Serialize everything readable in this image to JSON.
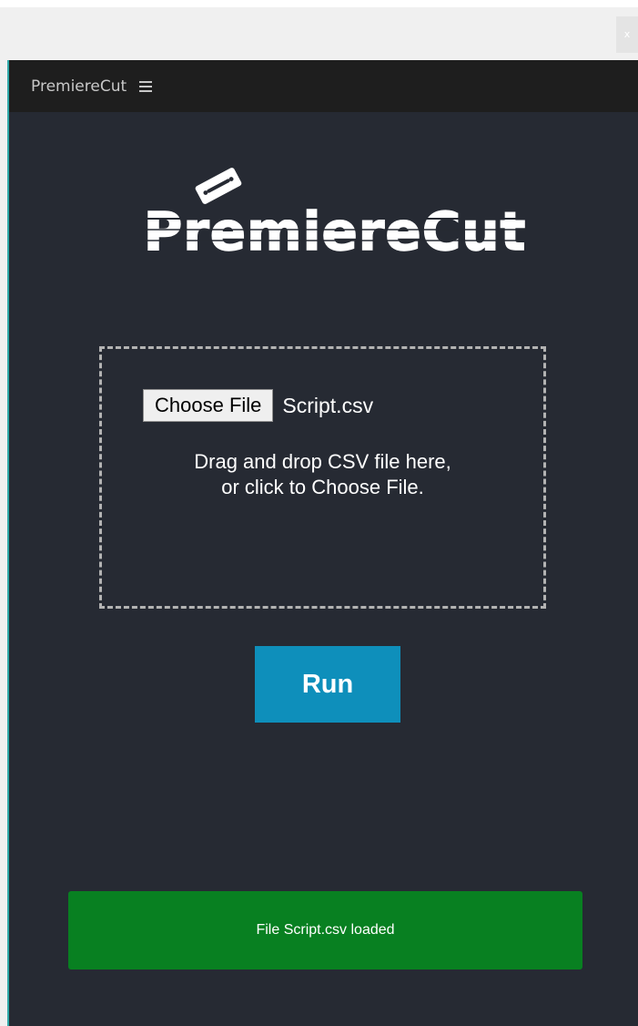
{
  "window": {
    "close_label": "x"
  },
  "panel": {
    "title": "PremiereCut",
    "menu_icon": "hamburger-menu-icon"
  },
  "logo": {
    "text": "PremiereCut",
    "icon": "razor-blade-icon"
  },
  "dropzone": {
    "choose_button_label": "Choose File",
    "selected_file": "Script.csv",
    "instruction_line1": "Drag and drop CSV file here,",
    "instruction_line2": "or click to Choose File."
  },
  "actions": {
    "run_label": "Run"
  },
  "status": {
    "message": "File Script.csv loaded"
  },
  "colors": {
    "panel_background": "#262a33",
    "header_background": "#1e1e1e",
    "run_button": "#0e8fbb",
    "status_success": "#088021",
    "accent_border": "#2fa8a8"
  }
}
